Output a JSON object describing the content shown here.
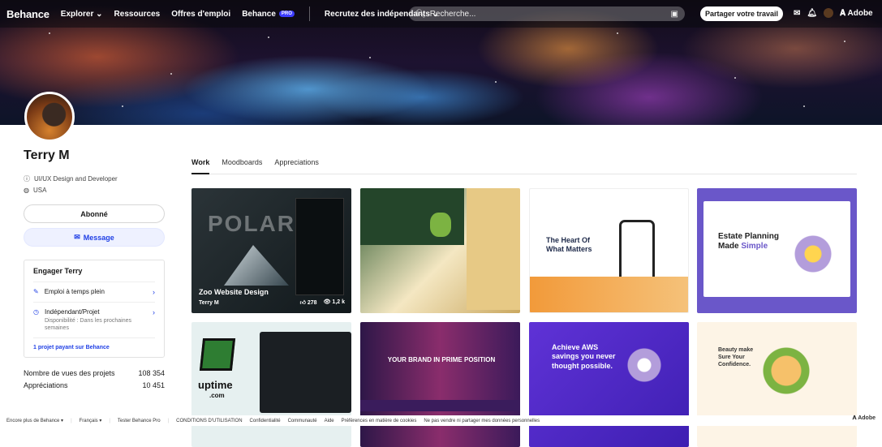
{
  "topbar": {
    "logo": "Behance",
    "nav": [
      "Explorer",
      "Ressources",
      "Offres d'emploi",
      "Behance"
    ],
    "pro_badge": "PRO",
    "hire": "Recrutez des indépendants",
    "search_placeholder": "Recherche...",
    "share": "Partager votre travail",
    "adobe": "Adobe"
  },
  "profile": {
    "name": "Terry M",
    "role": "UI/UX Design and Developer",
    "location": "USA",
    "follow": "Abonné",
    "message": "Message"
  },
  "engage": {
    "title": "Engager Terry",
    "fulltime": "Emploi à temps plein",
    "freelance": "Indépendant/Projet",
    "freelance_sub": "Disponibilité : Dans les prochaines semaines",
    "paid": "1 projet payant sur Behance"
  },
  "stats": [
    {
      "label": "Nombre de vues des projets",
      "value": "108 354"
    },
    {
      "label": "Appréciations",
      "value": "10 451"
    }
  ],
  "tabs": [
    "Work",
    "Moodboards",
    "Appreciations"
  ],
  "projects": [
    {
      "title": "Zoo Website Design",
      "author": "Terry M",
      "likes": "278",
      "views": "1,2 k"
    }
  ],
  "card_texts": {
    "polar": "POLAR",
    "heart": "The Heart Of What Matters",
    "estate_1": "Estate Planning",
    "estate_2": "Made ",
    "estate_3": "Simple",
    "uptime": "uptime",
    "uptime_sub": ".com",
    "prime": "YOUR BRAND IN PRIME POSITION",
    "aws": "Achieve AWS savings you never thought possible.",
    "beauty": "Beauty make Sure Your Confidence."
  },
  "footer": [
    "Encore plus de Behance",
    "Français",
    "Tester Behance Pro",
    "CONDITIONS D'UTILISATION",
    "Confidentialité",
    "Communauté",
    "Aide",
    "Préférences en matière de cookies",
    "Ne pas vendre ni partager mes données personnelles"
  ],
  "footer_adobe": "Adobe"
}
